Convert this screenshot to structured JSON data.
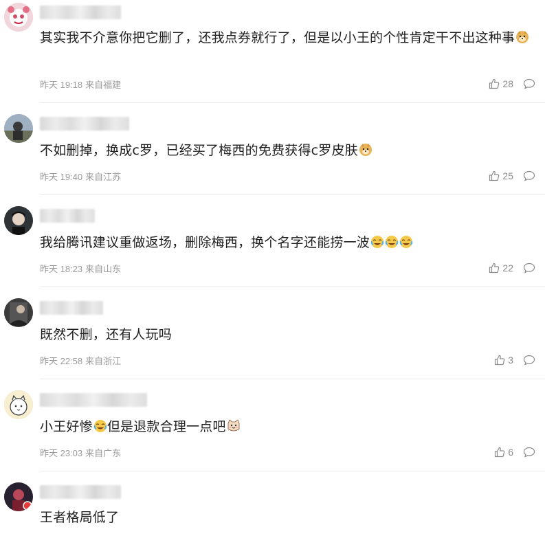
{
  "comments": [
    {
      "text": "其实我不介意你把它删了，还我点券就行了，但是以小王的个性肯定干不出这种事",
      "emojis": [
        "doge"
      ],
      "time": "昨天 19:18",
      "location": "来自福建",
      "likes": "28"
    },
    {
      "text": "不如删掉，换成c罗，已经买了梅西的免费获得c罗皮肤",
      "emojis": [
        "doge"
      ],
      "time": "昨天 19:40",
      "location": "来自江苏",
      "likes": "25"
    },
    {
      "text": "我给腾讯建议重做返场，删除梅西，换个名字还能捞一波",
      "emojis": [
        "laugh-cry",
        "laugh-cry",
        "laugh-cry"
      ],
      "time": "昨天 18:23",
      "location": "来自山东",
      "likes": "22"
    },
    {
      "text": "既然不删，还有人玩吗",
      "emojis": [],
      "time": "昨天 22:58",
      "location": "来自浙江",
      "likes": "3"
    },
    {
      "text_before": "小王好惨",
      "text_after": "但是退款合理一点吧",
      "emojis": [
        "laugh-cry",
        "cat"
      ],
      "time": "昨天 23:03",
      "location": "来自广东",
      "likes": "6"
    },
    {
      "text": "王者格局低了",
      "emojis": []
    }
  ],
  "icons": {
    "like": "thumbs-up-icon",
    "reply": "speech-bubble-icon"
  },
  "colors": {
    "meta": "#9a9a9a",
    "text": "#1f1f1f",
    "divider": "#e8e8e8"
  }
}
